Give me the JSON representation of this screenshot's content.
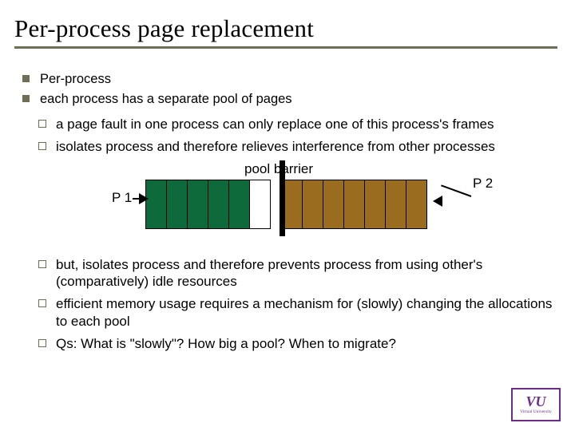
{
  "title": "Per-process page replacement",
  "b1": {
    "i0": "Per-process",
    "i1": "each process has a separate pool of pages"
  },
  "b2": {
    "i0": "a page fault in one process can only replace one of this process's frames",
    "i1": "isolates process and therefore relieves interference from other processes",
    "i2": "but, isolates process and therefore prevents process from using other's (comparatively) idle resources",
    "i3": "efficient memory usage requires a mechanism for (slowly) changing the allocations to each pool",
    "i4": "Qs: What is \"slowly\"?  How big a pool? When to migrate?"
  },
  "diagram": {
    "pool_label": "pool barrier",
    "p1": "P 1",
    "p2": "P 2",
    "left_cells": [
      "green",
      "green",
      "green",
      "green",
      "green",
      "white"
    ],
    "right_cells": [
      "brown",
      "brown",
      "brown",
      "brown",
      "brown",
      "brown",
      "brown"
    ],
    "colors": {
      "green": "#0e6a3b",
      "brown": "#996c1f",
      "white": "#ffffff"
    }
  },
  "logo": {
    "vu": "VU",
    "sub": "Virtual University"
  }
}
